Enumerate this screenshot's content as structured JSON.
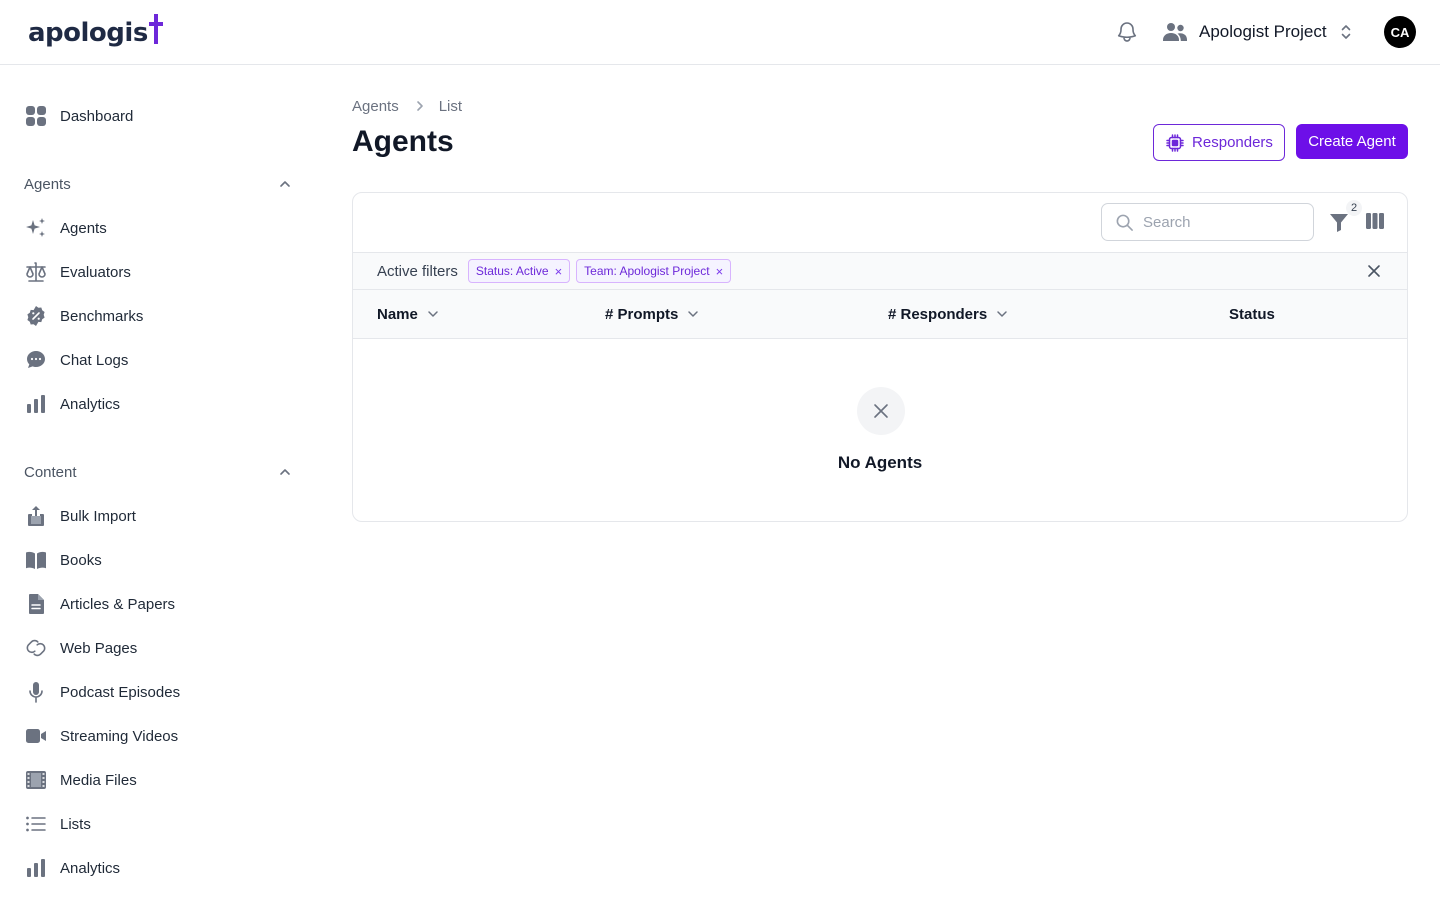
{
  "header": {
    "logo_text": "apologis",
    "team_name": "Apologist Project",
    "avatar_initials": "CA"
  },
  "sidebar": {
    "dashboard": "Dashboard",
    "agents_section": {
      "title": "Agents",
      "items": [
        "Agents",
        "Evaluators",
        "Benchmarks",
        "Chat Logs",
        "Analytics"
      ]
    },
    "content_section": {
      "title": "Content",
      "items": [
        "Bulk Import",
        "Books",
        "Articles & Papers",
        "Web Pages",
        "Podcast Episodes",
        "Streaming Videos",
        "Media Files",
        "Lists",
        "Analytics"
      ]
    }
  },
  "breadcrumb": [
    "Agents",
    "List"
  ],
  "page": {
    "title": "Agents",
    "responders_button": "Responders",
    "create_button": "Create Agent"
  },
  "table": {
    "search_placeholder": "Search",
    "filter_count": "2",
    "active_filters_label": "Active filters",
    "filters": [
      "Status: Active",
      "Team: Apologist Project"
    ],
    "columns": [
      "Name",
      "# Prompts",
      "# Responders",
      "Status"
    ],
    "empty_text": "No Agents"
  },
  "colors": {
    "accent": "#6d0fe8",
    "accent_text": "#6d28d9",
    "icon_gray": "#6b7280"
  }
}
